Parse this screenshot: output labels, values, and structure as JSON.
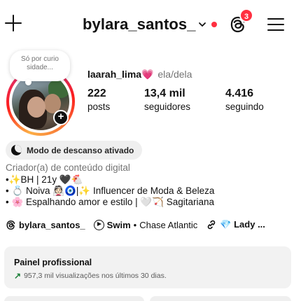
{
  "header": {
    "username": "bylara_santos_",
    "notification_count": "3"
  },
  "profile": {
    "note": "Só por curio sidade...",
    "full_name": "laarah_lima",
    "name_emoji": "💗",
    "pronouns": "ela/dela",
    "stats": [
      {
        "value": "222",
        "label": "posts"
      },
      {
        "value": "13,4 mil",
        "label": "seguidores"
      },
      {
        "value": "4.416",
        "label": "seguindo"
      }
    ]
  },
  "rest_mode": {
    "label": "Modo de descanso ativado"
  },
  "bio": {
    "category": "Criador(a) de conteúdo digital",
    "lines": [
      "•✨BH | 21y 🖤🐔",
      "• 💍 Noiva 👰🏻🧿|✨ Influencer de Moda & Beleza",
      "• 🌸 Espalhando amor e estilo | 🤍🏹 Sagitariana"
    ]
  },
  "links": {
    "threads_handle": "bylara_santos_",
    "music_title": "Swim",
    "music_separator": "•",
    "music_artist": "Chase Atlantic",
    "third_link": "💎 Lady ..."
  },
  "pro_dashboard": {
    "title": "Painel profissional",
    "subtitle": "957,3 mil visualizações nos últimos 30 dias."
  },
  "icons": {
    "create": "plus-icon",
    "dropdown": "chevron-down-icon",
    "threads": "threads-icon",
    "menu": "hamburger-menu-icon",
    "rest": "moon-icon",
    "music": "play-icon",
    "trend": "arrow-up-right-icon"
  },
  "colors": {
    "notification": "#ff2f40",
    "trend_up": "#1a7f37",
    "story_ring": "#e1306c"
  }
}
